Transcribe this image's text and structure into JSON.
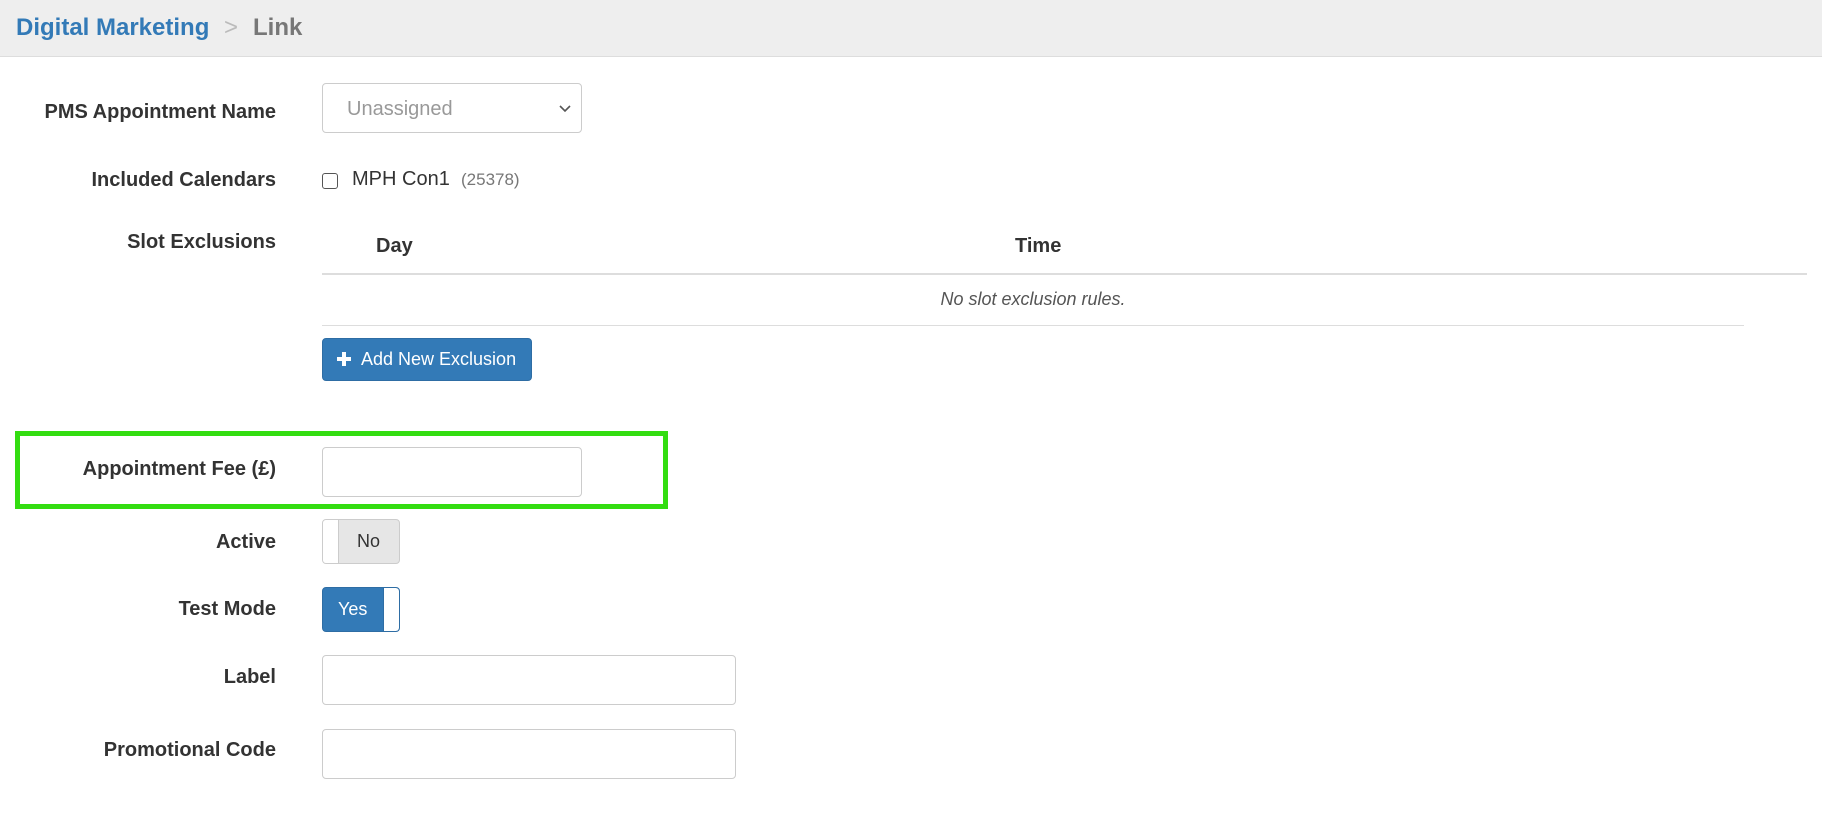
{
  "breadcrumb": {
    "parent": "Digital Marketing",
    "separator": ">",
    "current": "Link"
  },
  "form": {
    "pms_appointment_name": {
      "label": "PMS Appointment Name",
      "selected": "Unassigned"
    },
    "included_calendars": {
      "label": "Included Calendars",
      "items": [
        {
          "name": "MPH Con1",
          "id": "(25378)",
          "checked": false
        }
      ]
    },
    "slot_exclusions": {
      "label": "Slot Exclusions",
      "columns": [
        "Day",
        "Time"
      ],
      "empty_text": "No slot exclusion rules.",
      "add_button": "Add New Exclusion"
    },
    "appointment_fee": {
      "label": "Appointment Fee (£)",
      "value": ""
    },
    "active": {
      "label": "Active",
      "state": "No"
    },
    "test_mode": {
      "label": "Test Mode",
      "state": "Yes"
    },
    "link_label": {
      "label": "Label",
      "value": ""
    },
    "promotional_code": {
      "label": "Promotional Code",
      "value": ""
    }
  },
  "colors": {
    "accent": "#337ab7",
    "highlight": "#33dd11",
    "header_bg": "#eeeeee"
  },
  "icons": {
    "dropdown": "chevron-down-icon",
    "add": "plus-icon"
  }
}
